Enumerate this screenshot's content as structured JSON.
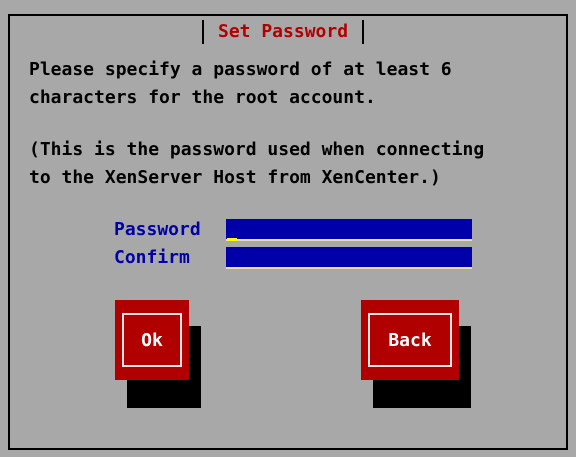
{
  "dialog": {
    "title": "Set Password",
    "instruction_line1": "Please specify a password of at least 6",
    "instruction_line2": "characters for the root account.",
    "note_line1": "(This is the password used when connecting",
    "note_line2": "to the XenServer Host from XenCenter.)"
  },
  "form": {
    "password_label": "Password",
    "password_value": "",
    "confirm_label": "Confirm",
    "confirm_value": ""
  },
  "buttons": {
    "ok_label": "Ok",
    "back_label": "Back"
  },
  "colors": {
    "background": "#a8a8a8",
    "title": "#b00000",
    "label": "#0000a8",
    "field": "#0000a8",
    "button": "#b00000"
  }
}
